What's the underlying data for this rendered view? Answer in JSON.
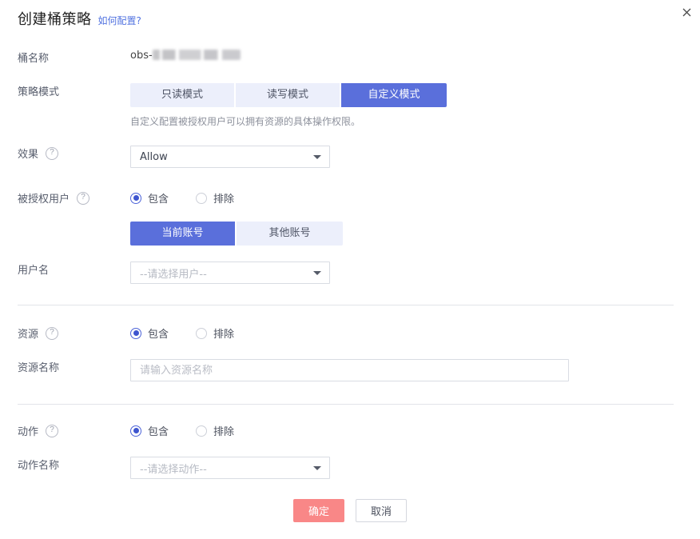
{
  "dialog": {
    "title": "创建桶策略",
    "howto_link": "如何配置?",
    "close_icon": "close-icon"
  },
  "fields": {
    "bucket_name": {
      "label": "桶名称",
      "value_prefix": "obs-",
      "value_masked": true
    },
    "policy_mode": {
      "label": "策略模式",
      "options": [
        "只读模式",
        "读写模式",
        "自定义模式"
      ],
      "selected": "自定义模式",
      "hint": "自定义配置被授权用户可以拥有资源的具体操作权限。"
    },
    "effect": {
      "label": "效果",
      "help_icon": "help-circle-icon",
      "value": "Allow",
      "caret_icon": "chevron-down-icon"
    },
    "grantee": {
      "label": "被授权用户",
      "help_icon": "help-circle-icon",
      "radios": [
        {
          "label": "包含",
          "checked": true
        },
        {
          "label": "排除",
          "checked": false
        }
      ],
      "account_tabs": {
        "options": [
          "当前账号",
          "其他账号"
        ],
        "selected": "当前账号"
      }
    },
    "username": {
      "label": "用户名",
      "placeholder": "--请选择用户--",
      "value": "",
      "caret_icon": "chevron-down-icon"
    },
    "resource": {
      "label": "资源",
      "help_icon": "help-circle-icon",
      "radios": [
        {
          "label": "包含",
          "checked": true
        },
        {
          "label": "排除",
          "checked": false
        }
      ]
    },
    "resource_name": {
      "label": "资源名称",
      "placeholder": "请输入资源名称",
      "value": ""
    },
    "action": {
      "label": "动作",
      "help_icon": "help-circle-icon",
      "radios": [
        {
          "label": "包含",
          "checked": true
        },
        {
          "label": "排除",
          "checked": false
        }
      ]
    },
    "action_name": {
      "label": "动作名称",
      "placeholder": "--请选择动作--",
      "value": "",
      "caret_icon": "chevron-down-icon"
    }
  },
  "footer": {
    "confirm_label": "确定",
    "cancel_label": "取消"
  },
  "colors": {
    "accent_blue": "#5a6fdb",
    "segment_inactive": "#eceffb",
    "primary_button": "#f98787",
    "link_blue": "#5273e0",
    "label_text": "#575d6c",
    "placeholder": "#b6bac3"
  },
  "help_glyph": "?"
}
